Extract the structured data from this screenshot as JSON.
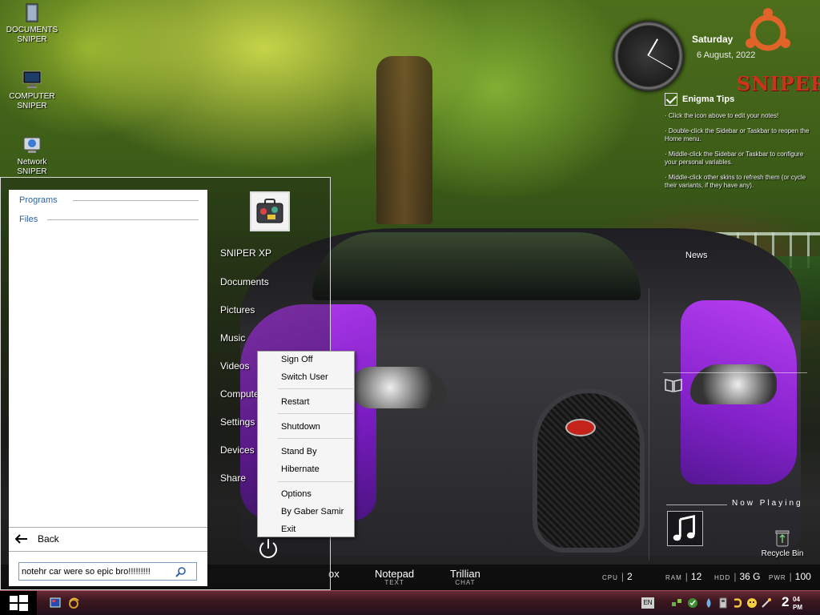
{
  "desktop_icons": [
    {
      "label_line1": "DOCUMENTS",
      "label_line2": "SNIPER",
      "icon": "documents-icon"
    },
    {
      "label_line1": "COMPUTER",
      "label_line2": "SNIPER",
      "icon": "computer-icon"
    },
    {
      "label_line1": "Network",
      "label_line2": "SNIPER",
      "icon": "network-icon"
    }
  ],
  "clock_widget": {
    "day": "Saturday",
    "date": "6 August, 2022"
  },
  "branding": {
    "logo_text": "SNIPER",
    "accent_color": "#c9351b"
  },
  "notes_widget": {
    "title": "Enigma Tips",
    "tips": [
      "· Click the icon above to edit your notes!",
      "· Double-click the Sidebar or Taskbar to reopen the Home menu.",
      "· Middle-click the Sidebar or Taskbar to configure your personal variables.",
      "· Middle-click other skins to refresh them (or cycle their variants, if they have any)."
    ]
  },
  "news_widget": {
    "label": "News"
  },
  "media_widget": {
    "label": "Now Playing"
  },
  "recycle_bin": {
    "label": "Recycle Bin"
  },
  "dock": {
    "apps": [
      {
        "name": "ox",
        "sub": ""
      },
      {
        "name": "Notepad",
        "sub": "TEXT"
      },
      {
        "name": "Trillian",
        "sub": "CHAT"
      }
    ],
    "stats": [
      {
        "label": "CPU",
        "value": "2"
      },
      {
        "label": "RAM",
        "value": "12"
      },
      {
        "label": "HDD",
        "value": "36 G"
      },
      {
        "label": "PWR",
        "value": "100"
      }
    ]
  },
  "start_menu": {
    "categories": [
      "Programs",
      "Files"
    ],
    "back_label": "Back",
    "search_value": "notehr car were so epic bro!!!!!!!!!",
    "right_links": [
      "SNIPER XP",
      "Documents",
      "Pictures",
      "Music",
      "Videos",
      "Computer",
      "Settings",
      "Devices",
      "Share"
    ]
  },
  "power_menu": {
    "groups": [
      [
        "Sign Off",
        "Switch User"
      ],
      [
        "Restart"
      ],
      [
        "Shutdown"
      ],
      [
        "Stand By",
        "Hibernate"
      ],
      [
        "Options",
        "By Gaber Samir",
        "Exit"
      ]
    ]
  },
  "taskbar": {
    "language": "EN",
    "time_hour": "2",
    "time_minutes": "04",
    "time_ampm": "PM",
    "colors": {
      "taskbar": "#3d1820",
      "accent_purple": "#9b2fe0"
    }
  }
}
